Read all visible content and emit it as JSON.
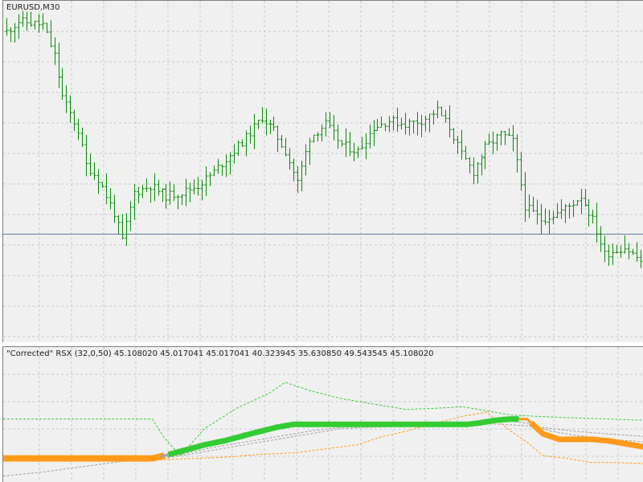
{
  "colors": {
    "background": "#f0f0f0",
    "grid": "#c8c8c8",
    "bars": "#0a8a0a",
    "level_line": "#5f7f9f",
    "rsx_up": "#33cc33",
    "rsx_down": "#ff9a1a",
    "rsx_neutral": "#a0a0a0",
    "band_upper": "#33cc33",
    "band_lower": "#ff9a1a",
    "band_mid": "#a0a0a0"
  },
  "chart_data": [
    {
      "type": "ohlc",
      "symbol_label": "EURUSD,M30",
      "grid": true,
      "bar_count": 160,
      "level": 0.318,
      "key_points": [
        [
          0,
          0.91
        ],
        [
          3,
          0.94
        ],
        [
          9,
          0.93
        ],
        [
          12,
          0.84
        ],
        [
          14,
          0.72
        ],
        [
          18,
          0.62
        ],
        [
          20,
          0.52
        ],
        [
          23,
          0.48
        ],
        [
          27,
          0.38
        ],
        [
          29,
          0.3
        ],
        [
          32,
          0.44
        ],
        [
          36,
          0.46
        ],
        [
          40,
          0.43
        ],
        [
          44,
          0.44
        ],
        [
          48,
          0.46
        ],
        [
          52,
          0.5
        ],
        [
          56,
          0.55
        ],
        [
          60,
          0.6
        ],
        [
          64,
          0.66
        ],
        [
          67,
          0.62
        ],
        [
          70,
          0.56
        ],
        [
          73,
          0.47
        ],
        [
          76,
          0.6
        ],
        [
          80,
          0.64
        ],
        [
          84,
          0.58
        ],
        [
          88,
          0.56
        ],
        [
          92,
          0.63
        ],
        [
          96,
          0.65
        ],
        [
          100,
          0.64
        ],
        [
          104,
          0.65
        ],
        [
          108,
          0.68
        ],
        [
          111,
          0.63
        ],
        [
          114,
          0.55
        ],
        [
          117,
          0.5
        ],
        [
          120,
          0.57
        ],
        [
          124,
          0.61
        ],
        [
          127,
          0.59
        ],
        [
          130,
          0.4
        ],
        [
          134,
          0.36
        ],
        [
          138,
          0.38
        ],
        [
          141,
          0.4
        ],
        [
          144,
          0.43
        ],
        [
          147,
          0.36
        ],
        [
          150,
          0.26
        ],
        [
          155,
          0.28
        ],
        [
          159,
          0.24
        ]
      ]
    },
    {
      "type": "line",
      "legend_text": "\"Corrected\" RSX (32,0,50) 45.108020 45.017041 45.017041 40.323945 35.630850 49.543545 45.108020",
      "x_count": 160,
      "ylim": [
        0,
        100
      ],
      "series": [
        {
          "role": "rsx",
          "key_points": [
            [
              0,
              18
            ],
            [
              37,
              18
            ],
            [
              40,
              20
            ],
            [
              45,
              24
            ],
            [
              50,
              28
            ],
            [
              55,
              31
            ],
            [
              60,
              35
            ],
            [
              64,
              38
            ],
            [
              68,
              41
            ],
            [
              72,
              43
            ],
            [
              80,
              43
            ],
            [
              90,
              43
            ],
            [
              100,
              43
            ],
            [
              110,
              43
            ],
            [
              115,
              43
            ],
            [
              118,
              44
            ],
            [
              122,
              46
            ],
            [
              126,
              47
            ],
            [
              130,
              47
            ],
            [
              134,
              36
            ],
            [
              138,
              32
            ],
            [
              146,
              32
            ],
            [
              150,
              31
            ],
            [
              154,
              29
            ],
            [
              158,
              27
            ],
            [
              160,
              26
            ]
          ],
          "up_range": [
            40,
            128
          ]
        },
        {
          "role": "band_upper",
          "key_points": [
            [
              0,
              47
            ],
            [
              37,
              47
            ],
            [
              40,
              33
            ],
            [
              44,
              20
            ],
            [
              50,
              40
            ],
            [
              58,
              55
            ],
            [
              66,
              66
            ],
            [
              70,
              74
            ],
            [
              76,
              68
            ],
            [
              84,
              62
            ],
            [
              92,
              58
            ],
            [
              100,
              54
            ],
            [
              108,
              55
            ],
            [
              114,
              56
            ],
            [
              120,
              53
            ],
            [
              126,
              50
            ],
            [
              132,
              49
            ],
            [
              140,
              48
            ],
            [
              150,
              47
            ],
            [
              160,
              46
            ]
          ]
        },
        {
          "role": "band_lower",
          "key_points": [
            [
              0,
              18
            ],
            [
              37,
              17
            ],
            [
              40,
              17
            ],
            [
              48,
              18
            ],
            [
              56,
              19
            ],
            [
              64,
              21
            ],
            [
              72,
              22
            ],
            [
              80,
              25
            ],
            [
              88,
              28
            ],
            [
              94,
              34
            ],
            [
              100,
              38
            ],
            [
              106,
              43
            ],
            [
              114,
              49
            ],
            [
              120,
              52
            ],
            [
              126,
              38
            ],
            [
              130,
              30
            ],
            [
              134,
              20
            ],
            [
              140,
              18
            ],
            [
              146,
              15
            ],
            [
              152,
              15
            ],
            [
              160,
              14
            ]
          ]
        },
        {
          "role": "band_mid_1",
          "key_points": [
            [
              0,
              5
            ],
            [
              10,
              8
            ],
            [
              20,
              12
            ],
            [
              30,
              16
            ],
            [
              37,
              17
            ],
            [
              44,
              21
            ],
            [
              52,
              26
            ],
            [
              60,
              30
            ],
            [
              68,
              34
            ],
            [
              76,
              38
            ],
            [
              84,
              41
            ],
            [
              92,
              42
            ],
            [
              100,
              43
            ],
            [
              108,
              44
            ],
            [
              116,
              44
            ],
            [
              124,
              43
            ],
            [
              130,
              42
            ],
            [
              136,
              40
            ],
            [
              142,
              38
            ],
            [
              150,
              36
            ],
            [
              160,
              34
            ]
          ]
        },
        {
          "role": "band_mid_2",
          "key_points": [
            [
              0,
              17
            ],
            [
              37,
              17
            ],
            [
              44,
              20
            ],
            [
              52,
              24
            ],
            [
              60,
              28
            ],
            [
              68,
              32
            ],
            [
              76,
              36
            ],
            [
              84,
              40
            ],
            [
              92,
              41
            ],
            [
              100,
              42
            ],
            [
              108,
              43
            ],
            [
              116,
              44
            ],
            [
              124,
              46
            ],
            [
              130,
              44
            ],
            [
              136,
              38
            ],
            [
              142,
              35
            ],
            [
              150,
              32
            ],
            [
              160,
              30
            ]
          ]
        }
      ]
    }
  ]
}
